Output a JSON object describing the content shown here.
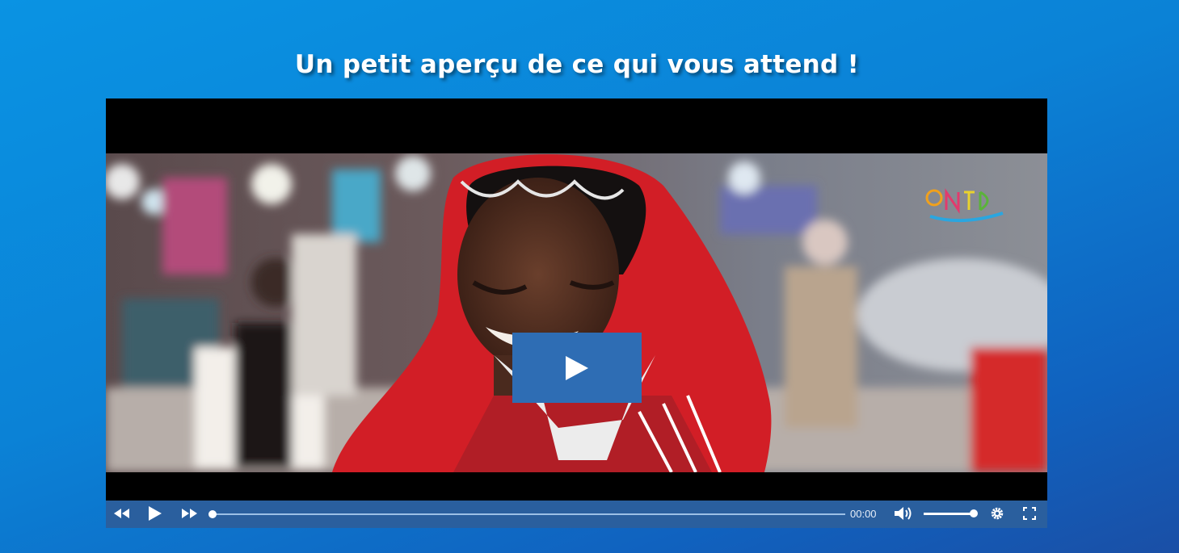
{
  "section": {
    "heading": "Un petit aperçu de ce qui vous attend !"
  },
  "player": {
    "current_time": "00:00",
    "progress_fraction": 0.0,
    "volume_fraction": 1.0,
    "watermark_logo": "ONTD",
    "icons": {
      "rewind": "rewind-icon",
      "play": "play-icon",
      "fast_forward": "fast-forward-icon",
      "volume": "volume-icon",
      "settings": "gear-icon",
      "fullscreen": "fullscreen-icon",
      "big_play": "play-icon"
    },
    "colors": {
      "control_bar": "#2a5f9e",
      "big_play_button": "#2e6db4",
      "background_top": "#0a93e3",
      "background_bottom": "#1a4fa6"
    }
  }
}
